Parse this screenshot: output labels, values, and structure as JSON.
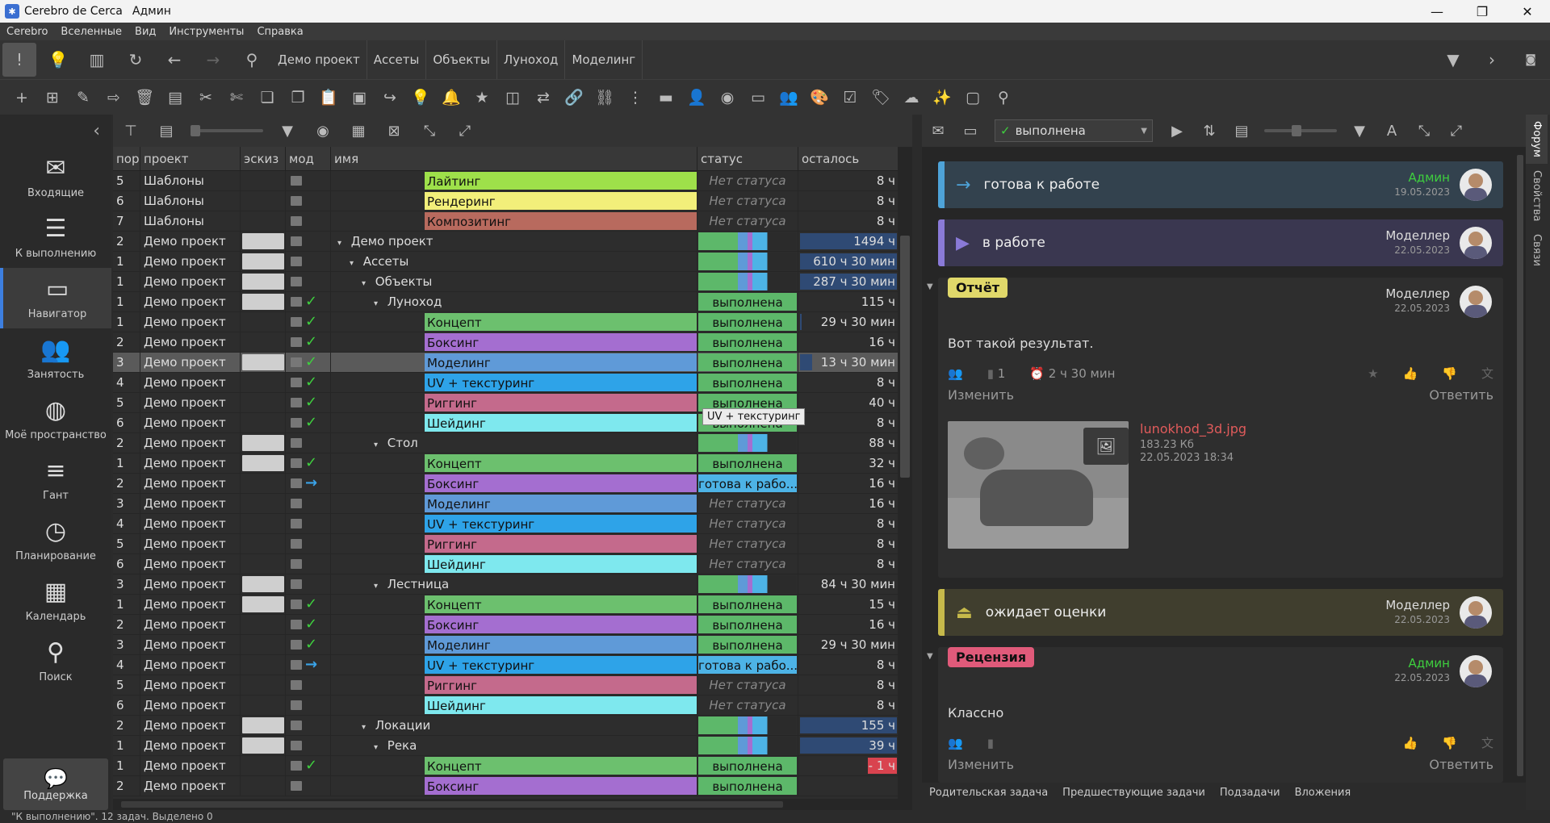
{
  "window": {
    "app_title": "Cerebro de Cerca",
    "user": "Админ"
  },
  "menu": [
    "Cerebro",
    "Вселенные",
    "Вид",
    "Инструменты",
    "Справка"
  ],
  "breadcrumbs": [
    "Демо проект",
    "Ассеты",
    "Объекты",
    "Луноход",
    "Моделинг"
  ],
  "sidebar": {
    "items": [
      {
        "label": "Входящие",
        "icon": "envelope-icon"
      },
      {
        "label": "К выполнению",
        "icon": "list-icon"
      },
      {
        "label": "Навигатор",
        "icon": "folder-icon",
        "active": true
      },
      {
        "label": "Занятость",
        "icon": "people-icon"
      },
      {
        "label": "Моё пространство",
        "icon": "globe-icon"
      },
      {
        "label": "Гант",
        "icon": "gantt-icon"
      },
      {
        "label": "Планирование",
        "icon": "clock-plus-icon"
      },
      {
        "label": "Календарь",
        "icon": "calendar-icon"
      },
      {
        "label": "Поиск",
        "icon": "search-icon"
      }
    ],
    "support": "Поддержка"
  },
  "grid": {
    "headers": {
      "n": "пор",
      "project": "проект",
      "sketch": "эскиз",
      "mod": "мод",
      "name": "имя",
      "status": "статус",
      "remaining": "осталось"
    },
    "rows": [
      {
        "n": "5",
        "project": "Шаблоны",
        "indent": 4,
        "name": "Лайтинг",
        "color": "#9ee04a",
        "status": "Нет статуса",
        "remaining": "8 ч"
      },
      {
        "n": "6",
        "project": "Шаблоны",
        "indent": 4,
        "name": "Рендеринг",
        "color": "#f2ef7a",
        "status": "Нет статуса",
        "remaining": "8 ч"
      },
      {
        "n": "7",
        "project": "Шаблоны",
        "indent": 4,
        "name": "Композитинг",
        "color": "#b86a5e",
        "status": "Нет статуса",
        "remaining": "8 ч"
      },
      {
        "n": "2",
        "project": "Демо проект",
        "indent": 0,
        "tog": "▾",
        "name": "Демо проект",
        "thumb": true,
        "status_bar": true,
        "remaining": "1494 ч",
        "rem_bar": 1.0
      },
      {
        "n": "1",
        "project": "Демо проект",
        "indent": 1,
        "tog": "▾",
        "name": "Ассеты",
        "thumb": true,
        "status_bar": true,
        "remaining": "610 ч 30 мин",
        "rem_bar": 1.0
      },
      {
        "n": "1",
        "project": "Демо проект",
        "indent": 2,
        "tog": "▾",
        "name": "Объекты",
        "thumb": true,
        "status_bar": true,
        "remaining": "287 ч 30 мин",
        "rem_bar": 1.0
      },
      {
        "n": "1",
        "project": "Демо проект",
        "indent": 3,
        "tog": "▾",
        "name": "Луноход",
        "thumb": true,
        "check": true,
        "status": "выполнена",
        "status_color": "#5db86a",
        "remaining": "115 ч"
      },
      {
        "n": "1",
        "project": "Демо проект",
        "indent": 4,
        "name": "Концепт",
        "color": "#6cc06e",
        "check": true,
        "status": "выполнена",
        "status_color": "#5db86a",
        "remaining": "29 ч 30 мин",
        "rem_bar": 0.05
      },
      {
        "n": "2",
        "project": "Демо проект",
        "indent": 4,
        "name": "Боксинг",
        "color": "#a46ed0",
        "check": true,
        "status": "выполнена",
        "status_color": "#5db86a",
        "remaining": "16 ч"
      },
      {
        "n": "3",
        "project": "Демо проект",
        "indent": 4,
        "name": "Моделинг",
        "color": "#5f9ad8",
        "thumb": true,
        "check": true,
        "status": "выполнена",
        "status_color": "#5db86a",
        "remaining": "13 ч 30 мин",
        "rem_bar": 0.15,
        "selected": true
      },
      {
        "n": "4",
        "project": "Демо проект",
        "indent": 4,
        "name": "UV + текстуринг",
        "color": "#2ea3e8",
        "check": true,
        "status": "выполнена",
        "status_color": "#5db86a",
        "remaining": "8 ч"
      },
      {
        "n": "5",
        "project": "Демо проект",
        "indent": 4,
        "name": "Риггинг",
        "color": "#c46a8c",
        "check": true,
        "status": "выполнена",
        "status_color": "#5db86a",
        "remaining": "40 ч"
      },
      {
        "n": "6",
        "project": "Демо проект",
        "indent": 4,
        "name": "Шейдинг",
        "color": "#7ee8ee",
        "check": true,
        "status": "выполнена",
        "status_color": "#5db86a",
        "remaining": "8 ч"
      },
      {
        "n": "2",
        "project": "Демо проект",
        "indent": 3,
        "tog": "▾",
        "name": "Стол",
        "thumb": true,
        "status_bar": true,
        "remaining": "88 ч"
      },
      {
        "n": "1",
        "project": "Демо проект",
        "indent": 4,
        "name": "Концепт",
        "color": "#6cc06e",
        "thumb": true,
        "check": true,
        "status": "выполнена",
        "status_color": "#5db86a",
        "remaining": "32 ч"
      },
      {
        "n": "2",
        "project": "Демо проект",
        "indent": 4,
        "name": "Боксинг",
        "color": "#a46ed0",
        "arrow": true,
        "status": "готова к рабо...",
        "status_color": "#4db3e6",
        "remaining": "16 ч"
      },
      {
        "n": "3",
        "project": "Демо проект",
        "indent": 4,
        "name": "Моделинг",
        "color": "#5f9ad8",
        "status": "Нет статуса",
        "remaining": "16 ч"
      },
      {
        "n": "4",
        "project": "Демо проект",
        "indent": 4,
        "name": "UV + текстуринг",
        "color": "#2ea3e8",
        "status": "Нет статуса",
        "remaining": "8 ч"
      },
      {
        "n": "5",
        "project": "Демо проект",
        "indent": 4,
        "name": "Риггинг",
        "color": "#c46a8c",
        "status": "Нет статуса",
        "remaining": "8 ч"
      },
      {
        "n": "6",
        "project": "Демо проект",
        "indent": 4,
        "name": "Шейдинг",
        "color": "#7ee8ee",
        "status": "Нет статуса",
        "remaining": "8 ч"
      },
      {
        "n": "3",
        "project": "Демо проект",
        "indent": 3,
        "tog": "▾",
        "name": "Лестница",
        "thumb": true,
        "status_bar": true,
        "remaining": "84 ч 30 мин"
      },
      {
        "n": "1",
        "project": "Демо проект",
        "indent": 4,
        "name": "Концепт",
        "color": "#6cc06e",
        "thumb": true,
        "check": true,
        "status": "выполнена",
        "status_color": "#5db86a",
        "remaining": "15 ч"
      },
      {
        "n": "2",
        "project": "Демо проект",
        "indent": 4,
        "name": "Боксинг",
        "color": "#a46ed0",
        "check": true,
        "status": "выполнена",
        "status_color": "#5db86a",
        "remaining": "16 ч"
      },
      {
        "n": "3",
        "project": "Демо проект",
        "indent": 4,
        "name": "Моделинг",
        "color": "#5f9ad8",
        "check": true,
        "status": "выполнена",
        "status_color": "#5db86a",
        "remaining": "29 ч 30 мин"
      },
      {
        "n": "4",
        "project": "Демо проект",
        "indent": 4,
        "name": "UV + текстуринг",
        "color": "#2ea3e8",
        "arrow": true,
        "status": "готова к рабо...",
        "status_color": "#4db3e6",
        "remaining": "8 ч"
      },
      {
        "n": "5",
        "project": "Демо проект",
        "indent": 4,
        "name": "Риггинг",
        "color": "#c46a8c",
        "status": "Нет статуса",
        "remaining": "8 ч"
      },
      {
        "n": "6",
        "project": "Демо проект",
        "indent": 4,
        "name": "Шейдинг",
        "color": "#7ee8ee",
        "status": "Нет статуса",
        "remaining": "8 ч"
      },
      {
        "n": "2",
        "project": "Демо проект",
        "indent": 2,
        "tog": "▾",
        "name": "Локации",
        "thumb": true,
        "status_bar": true,
        "remaining": "155 ч",
        "rem_bar": 1.0
      },
      {
        "n": "1",
        "project": "Демо проект",
        "indent": 3,
        "tog": "▾",
        "name": "Река",
        "thumb": true,
        "status_bar": true,
        "remaining": "39 ч",
        "rem_bar": 1.0
      },
      {
        "n": "1",
        "project": "Демо проект",
        "indent": 4,
        "name": "Концепт",
        "color": "#6cc06e",
        "check": true,
        "status": "выполнена",
        "status_color": "#5db86a",
        "remaining": "- 1 ч",
        "rem_red": true
      },
      {
        "n": "2",
        "project": "Демо проект",
        "indent": 4,
        "name": "Боксинг",
        "color": "#a46ed0",
        "status": "выполнена",
        "status_color": "#5db86a",
        "remaining": ""
      }
    ]
  },
  "tooltip": "UV + текстуринг",
  "status_select": "выполнена",
  "right_tabs": [
    "Форум",
    "Свойства",
    "Связи"
  ],
  "forum": {
    "events": [
      {
        "label": "готова к работе",
        "author": "Админ",
        "date": "19.05.2023",
        "color": "#4ea3d8",
        "bg": "#33424e",
        "author_color": "#3ecf3e"
      },
      {
        "label": "в работе",
        "author": "Моделлер",
        "date": "22.05.2023",
        "color": "#8a7ad8",
        "bg": "#3a3750",
        "author_color": "#dddddd"
      }
    ],
    "report": {
      "tag": "Отчёт",
      "tag_color": "#e0d86a",
      "author": "Моделлер",
      "date": "22.05.2023",
      "text": "Вот такой результат.",
      "attach_count": "1",
      "time": "2 ч 30 мин",
      "edit": "Изменить",
      "reply": "Ответить",
      "file": "lunokhod_3d.jpg",
      "size": "183.23 Кб",
      "file_date": "22.05.2023 18:34"
    },
    "waiting": {
      "label": "ожидает оценки",
      "author": "Моделлер",
      "date": "22.05.2023",
      "color": "#c6b94a",
      "bg": "#403e2e"
    },
    "review": {
      "tag": "Рецензия",
      "tag_color": "#e05a7a",
      "author": "Админ",
      "date": "22.05.2023",
      "text": "Классно",
      "edit": "Изменить",
      "reply": "Ответить"
    }
  },
  "forum_tabs": [
    "Родительская задача",
    "Предшествующие задачи",
    "Подзадачи",
    "Вложения"
  ],
  "statusbar": "\"К выполнению\". 12 задач. Выделено 0"
}
